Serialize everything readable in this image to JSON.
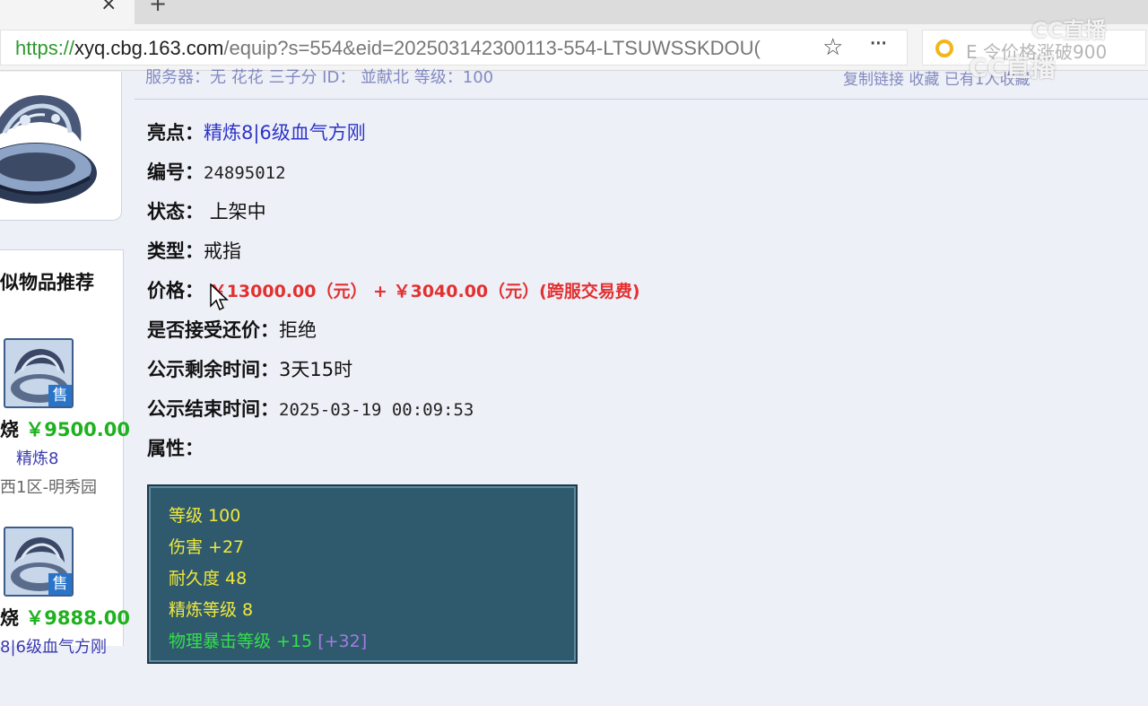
{
  "browser": {
    "tab_close_icon": "×",
    "new_tab_icon": "+",
    "url": {
      "scheme": "https://",
      "host": "xyq.cbg.163.com",
      "path": "/equip?s=554&eid=202503142300113-554-LTSUWSSKDOU("
    },
    "star_icon": "☆",
    "menu_icon": "···",
    "search_placeholder": "E 令价格涨破900",
    "watermark_top": "CC直播",
    "watermark_bottom": "CC直播"
  },
  "header_cut": {
    "left": "服务器：无  花花  三子分     ID： 並献北      等级：100",
    "right": "复制链接    收藏     已有1人收藏"
  },
  "sidebar": {
    "title": "似物品推荐",
    "items": [
      {
        "badge": "售",
        "prefix": "烧",
        "price": "￥9500.00",
        "name": "精炼8",
        "server": "西1区-明秀园"
      },
      {
        "badge": "售",
        "prefix": "烧",
        "price": "￥9888.00",
        "name": "8|6级血气方刚"
      }
    ]
  },
  "detail": {
    "highlight_label": "亮点：",
    "highlight_value": "精炼8|6级血气方刚",
    "id_label": "编号：",
    "id_value": "24895012",
    "status_label": "状态：",
    "status_value": "上架中",
    "type_label": "类型：",
    "type_value": "戒指",
    "price_label": "价格：",
    "price_value": "￥13000.00（元） + ￥3040.00（元）(跨服交易费)",
    "counter_label": "是否接受还价：",
    "counter_value": "拒绝",
    "remain_label": "公示剩余时间：",
    "remain_value": "3天15时",
    "end_label": "公示结束时间：",
    "end_value": "2025-03-19 00:09:53",
    "attr_label": "属性："
  },
  "attributes": [
    {
      "text": "等级 100",
      "color": "#f0e83a"
    },
    {
      "text": "伤害 +27",
      "color": "#f0e83a"
    },
    {
      "text": "耐久度 48",
      "color": "#f0e83a"
    },
    {
      "text": "精炼等级 8",
      "color": "#f0e83a"
    },
    {
      "text": "物理暴击等级 +15",
      "extra": "[+32]",
      "color": "#33e04a"
    }
  ]
}
